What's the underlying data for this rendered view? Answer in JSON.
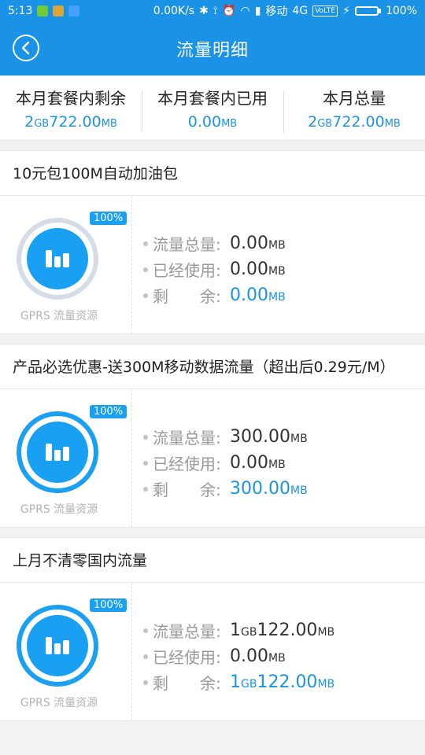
{
  "status_bar": {
    "time": "5:13",
    "speed": "0.00K/s",
    "carrier": "移动",
    "network": "4G",
    "volte": "VoLTE",
    "battery": "100%"
  },
  "app_bar": {
    "title": "流量明细",
    "back_icon": "chevron-left-icon"
  },
  "summary": {
    "remaining_label": "本月套餐内剩余",
    "remaining_value": {
      "gb": "2",
      "mb": "722.00"
    },
    "used_label": "本月套餐内已用",
    "used_value": "0.00",
    "total_label": "本月总量",
    "total_value": {
      "gb": "2",
      "mb": "722.00"
    },
    "unit_gb": "GB",
    "unit_mb": "MB"
  },
  "labels": {
    "total": "流量总量:",
    "used": "已经使用:",
    "remain": "剩　　余:"
  },
  "packages": [
    {
      "title": "10元包100M自动加油包",
      "badge": "100%",
      "resource": "GPRS 流量资源",
      "total": {
        "gb": "",
        "mb": "0.00"
      },
      "used": "0.00",
      "remain": {
        "gb": "",
        "mb": "0.00"
      },
      "ring_state": "faded"
    },
    {
      "title": "产品必选优惠-送300M移动数据流量（超出后0.29元/M）",
      "badge": "100%",
      "resource": "GPRS 流量资源",
      "total": {
        "gb": "",
        "mb": "300.00"
      },
      "used": "0.00",
      "remain": {
        "gb": "",
        "mb": "300.00"
      },
      "ring_state": "active"
    },
    {
      "title": "上月不清零国内流量",
      "badge": "100%",
      "resource": "GPRS 流量资源",
      "total": {
        "gb": "1",
        "mb": "122.00"
      },
      "used": "0.00",
      "remain": {
        "gb": "1",
        "mb": "122.00"
      },
      "ring_state": "active"
    }
  ],
  "colors": {
    "primary": "#1a93e6",
    "ring": "#1aa0f2",
    "ring_faded": "#d6dce6"
  }
}
